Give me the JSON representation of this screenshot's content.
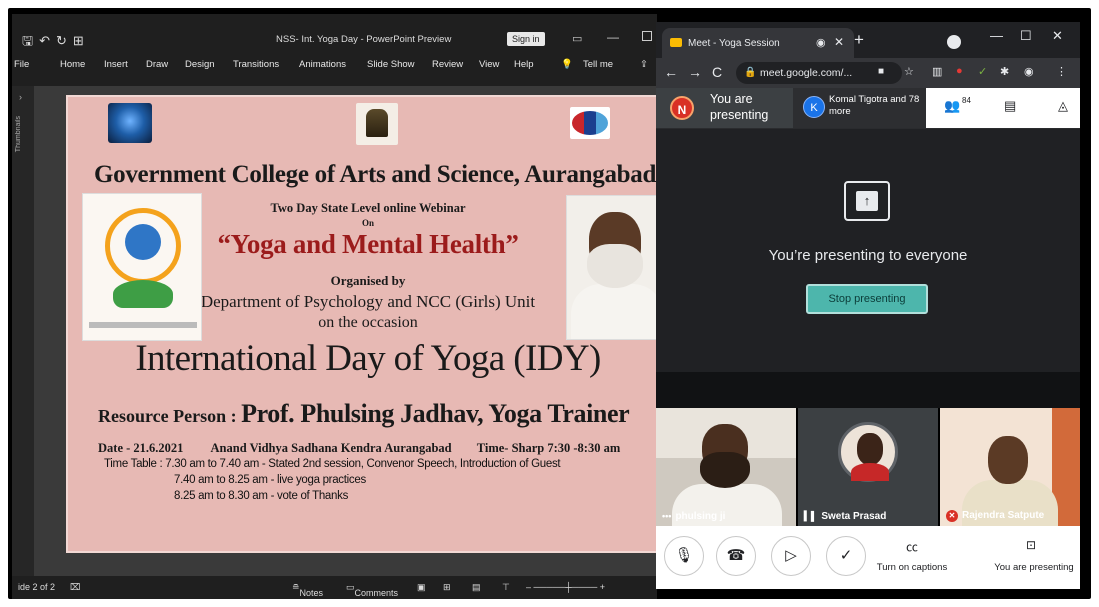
{
  "ppt": {
    "window_title": "NSS- Int. Yoga Day - PowerPoint Preview",
    "sign_in": "Sign in",
    "ribbon_tabs": [
      "File",
      "Home",
      "Insert",
      "Draw",
      "Design",
      "Transitions",
      "Animations",
      "Slide Show",
      "Review",
      "View",
      "Help"
    ],
    "tell_me": "Tell me",
    "side_label": "Thumbnails",
    "status": {
      "slide": "ide 2 of 2",
      "notes": "Notes",
      "comments": "Comments"
    },
    "slide": {
      "college": "Government College of Arts and Science, Aurangabad",
      "webinar": "Two Day State Level online Webinar",
      "on": "On",
      "topic": "“Yoga and Mental Health”",
      "organised": "Organised by",
      "department": "Department of Psychology and NCC (Girls) Unit",
      "occasion": "on the occasion",
      "idy": "International Day of Yoga (IDY)",
      "resource_label": "Resource Person : ",
      "resource_name": "Prof. Phulsing Jadhav, Yoga Trainer",
      "date": "Date - 21.6.2021",
      "venue": "Anand Vidhya Sadhana Kendra Aurangabad",
      "time": "Time- Sharp 7:30 -8:30 am",
      "timetable": [
        "Time Table : 7.30 am to 7.40 am - Stated 2nd session, Convenor Speech, Introduction of Guest",
        "7.40 am to 8.25 am - live yoga practices",
        "8.25 am to 8.30 am - vote of Thanks"
      ]
    }
  },
  "meet": {
    "tab_title": "Meet - Yoga Session",
    "url": "meet.google.com/...",
    "presenting": {
      "you_initial": "N",
      "you_label": "You are presenting",
      "other_initial": "K",
      "other_label": "Komal Tigotra and 78 more",
      "participant_count": "84"
    },
    "stage_message": "You’re presenting to everyone",
    "stop_button": "Stop presenting",
    "participants": [
      "phulsing ji",
      "Sweta Prasad",
      "Rajendra Satpute"
    ],
    "controls": {
      "captions": "Turn on captions",
      "presenting": "You are presenting"
    }
  },
  "colors": {
    "slide_bg": "#e7b9b4",
    "topic_red": "#9b1b1b",
    "stop_button": "#4db6ac",
    "meet_dark": "#202124"
  }
}
